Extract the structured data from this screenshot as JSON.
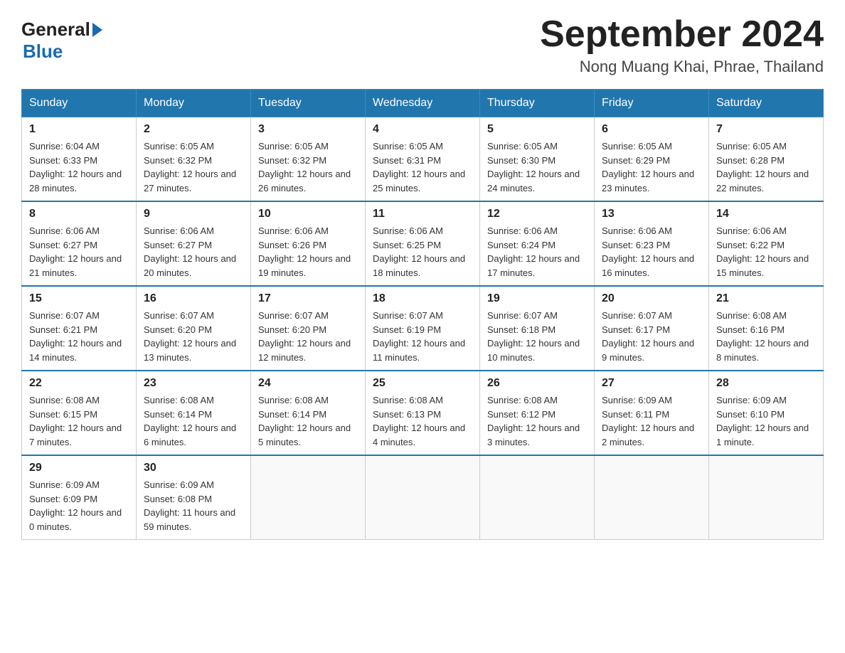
{
  "header": {
    "logo": {
      "text_general": "General",
      "text_blue": "Blue"
    },
    "title": "September 2024",
    "subtitle": "Nong Muang Khai, Phrae, Thailand"
  },
  "calendar": {
    "days_of_week": [
      "Sunday",
      "Monday",
      "Tuesday",
      "Wednesday",
      "Thursday",
      "Friday",
      "Saturday"
    ],
    "weeks": [
      [
        {
          "day": "1",
          "sunrise": "6:04 AM",
          "sunset": "6:33 PM",
          "daylight": "12 hours and 28 minutes."
        },
        {
          "day": "2",
          "sunrise": "6:05 AM",
          "sunset": "6:32 PM",
          "daylight": "12 hours and 27 minutes."
        },
        {
          "day": "3",
          "sunrise": "6:05 AM",
          "sunset": "6:32 PM",
          "daylight": "12 hours and 26 minutes."
        },
        {
          "day": "4",
          "sunrise": "6:05 AM",
          "sunset": "6:31 PM",
          "daylight": "12 hours and 25 minutes."
        },
        {
          "day": "5",
          "sunrise": "6:05 AM",
          "sunset": "6:30 PM",
          "daylight": "12 hours and 24 minutes."
        },
        {
          "day": "6",
          "sunrise": "6:05 AM",
          "sunset": "6:29 PM",
          "daylight": "12 hours and 23 minutes."
        },
        {
          "day": "7",
          "sunrise": "6:05 AM",
          "sunset": "6:28 PM",
          "daylight": "12 hours and 22 minutes."
        }
      ],
      [
        {
          "day": "8",
          "sunrise": "6:06 AM",
          "sunset": "6:27 PM",
          "daylight": "12 hours and 21 minutes."
        },
        {
          "day": "9",
          "sunrise": "6:06 AM",
          "sunset": "6:27 PM",
          "daylight": "12 hours and 20 minutes."
        },
        {
          "day": "10",
          "sunrise": "6:06 AM",
          "sunset": "6:26 PM",
          "daylight": "12 hours and 19 minutes."
        },
        {
          "day": "11",
          "sunrise": "6:06 AM",
          "sunset": "6:25 PM",
          "daylight": "12 hours and 18 minutes."
        },
        {
          "day": "12",
          "sunrise": "6:06 AM",
          "sunset": "6:24 PM",
          "daylight": "12 hours and 17 minutes."
        },
        {
          "day": "13",
          "sunrise": "6:06 AM",
          "sunset": "6:23 PM",
          "daylight": "12 hours and 16 minutes."
        },
        {
          "day": "14",
          "sunrise": "6:06 AM",
          "sunset": "6:22 PM",
          "daylight": "12 hours and 15 minutes."
        }
      ],
      [
        {
          "day": "15",
          "sunrise": "6:07 AM",
          "sunset": "6:21 PM",
          "daylight": "12 hours and 14 minutes."
        },
        {
          "day": "16",
          "sunrise": "6:07 AM",
          "sunset": "6:20 PM",
          "daylight": "12 hours and 13 minutes."
        },
        {
          "day": "17",
          "sunrise": "6:07 AM",
          "sunset": "6:20 PM",
          "daylight": "12 hours and 12 minutes."
        },
        {
          "day": "18",
          "sunrise": "6:07 AM",
          "sunset": "6:19 PM",
          "daylight": "12 hours and 11 minutes."
        },
        {
          "day": "19",
          "sunrise": "6:07 AM",
          "sunset": "6:18 PM",
          "daylight": "12 hours and 10 minutes."
        },
        {
          "day": "20",
          "sunrise": "6:07 AM",
          "sunset": "6:17 PM",
          "daylight": "12 hours and 9 minutes."
        },
        {
          "day": "21",
          "sunrise": "6:08 AM",
          "sunset": "6:16 PM",
          "daylight": "12 hours and 8 minutes."
        }
      ],
      [
        {
          "day": "22",
          "sunrise": "6:08 AM",
          "sunset": "6:15 PM",
          "daylight": "12 hours and 7 minutes."
        },
        {
          "day": "23",
          "sunrise": "6:08 AM",
          "sunset": "6:14 PM",
          "daylight": "12 hours and 6 minutes."
        },
        {
          "day": "24",
          "sunrise": "6:08 AM",
          "sunset": "6:14 PM",
          "daylight": "12 hours and 5 minutes."
        },
        {
          "day": "25",
          "sunrise": "6:08 AM",
          "sunset": "6:13 PM",
          "daylight": "12 hours and 4 minutes."
        },
        {
          "day": "26",
          "sunrise": "6:08 AM",
          "sunset": "6:12 PM",
          "daylight": "12 hours and 3 minutes."
        },
        {
          "day": "27",
          "sunrise": "6:09 AM",
          "sunset": "6:11 PM",
          "daylight": "12 hours and 2 minutes."
        },
        {
          "day": "28",
          "sunrise": "6:09 AM",
          "sunset": "6:10 PM",
          "daylight": "12 hours and 1 minute."
        }
      ],
      [
        {
          "day": "29",
          "sunrise": "6:09 AM",
          "sunset": "6:09 PM",
          "daylight": "12 hours and 0 minutes."
        },
        {
          "day": "30",
          "sunrise": "6:09 AM",
          "sunset": "6:08 PM",
          "daylight": "11 hours and 59 minutes."
        },
        null,
        null,
        null,
        null,
        null
      ]
    ]
  }
}
